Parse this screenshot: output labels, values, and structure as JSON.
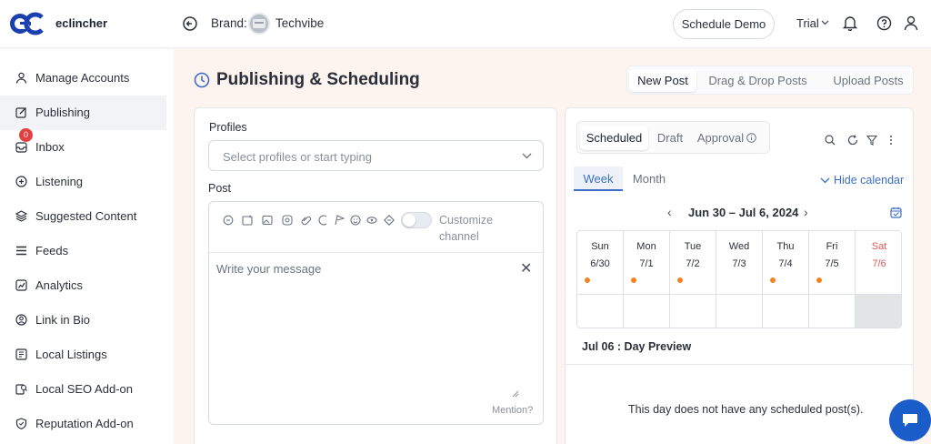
{
  "app": {
    "name": "eclincher",
    "brand_label": "Brand:",
    "brand_value": "Techvibe",
    "schedule_demo": "Schedule Demo",
    "trial": "Trial"
  },
  "sidebar": {
    "items": [
      {
        "label": "Manage Accounts",
        "icon": "user-icon"
      },
      {
        "label": "Publishing",
        "icon": "edit-icon",
        "active": true
      },
      {
        "label": "Inbox",
        "icon": "inbox-icon",
        "badge": "0"
      },
      {
        "label": "Listening",
        "icon": "ear-icon"
      },
      {
        "label": "Suggested Content",
        "icon": "layers-icon"
      },
      {
        "label": "Feeds",
        "icon": "list-icon"
      },
      {
        "label": "Analytics",
        "icon": "chart-icon"
      },
      {
        "label": "Link in Bio",
        "icon": "link-icon"
      },
      {
        "label": "Local Listings",
        "icon": "map-icon"
      },
      {
        "label": "Local SEO Add-on",
        "icon": "seo-icon"
      },
      {
        "label": "Reputation Add-on",
        "icon": "shield-icon"
      }
    ]
  },
  "header": {
    "title": "Publishing & Scheduling",
    "tabs": [
      "New Post",
      "Drag & Drop Posts",
      "Upload Posts"
    ]
  },
  "composer": {
    "profiles_label": "Profiles",
    "profiles_placeholder": "Select profiles or start typing",
    "post_label": "Post",
    "customize_channel": "Customize channel",
    "message_placeholder": "Write your message",
    "mention": "Mention?"
  },
  "schedule": {
    "status_tabs": [
      "Scheduled",
      "Draft",
      "Approval"
    ],
    "view_tabs": [
      "Week",
      "Month"
    ],
    "hide_calendar": "Hide calendar",
    "range": "Jun 30 – Jul 6, 2024",
    "days": [
      {
        "day": "Sun",
        "date": "6/30",
        "dot": true
      },
      {
        "day": "Mon",
        "date": "7/1",
        "dot": true
      },
      {
        "day": "Tue",
        "date": "7/2",
        "dot": true
      },
      {
        "day": "Wed",
        "date": "7/3",
        "dot": false
      },
      {
        "day": "Thu",
        "date": "7/4",
        "dot": true
      },
      {
        "day": "Fri",
        "date": "7/5",
        "dot": true
      },
      {
        "day": "Sat",
        "date": "7/6",
        "dot": false
      }
    ],
    "preview_title": "Jul 06 : Day Preview",
    "preview_empty": "This day does not have any scheduled post(s).",
    "accent": "#3b6fc4",
    "dot_color": "#f58220"
  }
}
